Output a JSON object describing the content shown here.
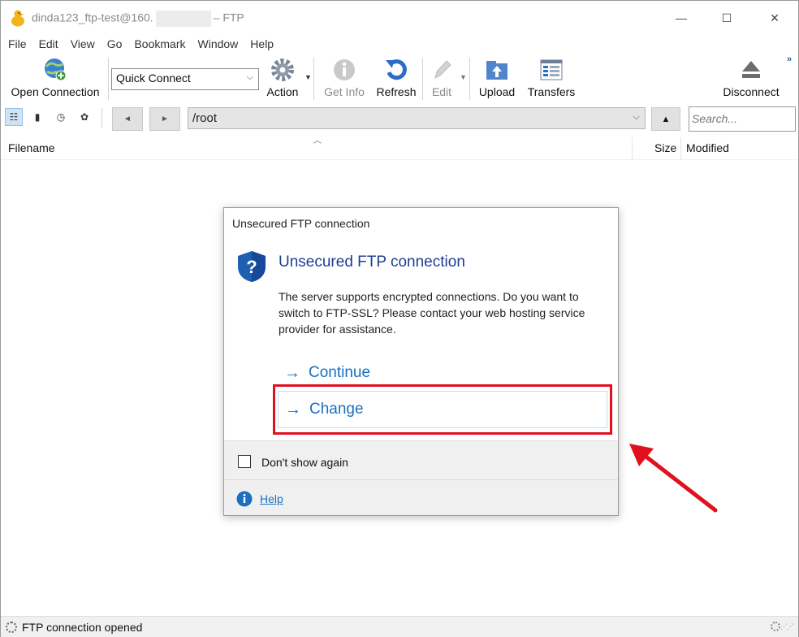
{
  "window": {
    "title_prefix": "dinda123_ftp-test@160.",
    "title_suffix": "– FTP",
    "controls": {
      "minimize": "—",
      "maximize": "☐",
      "close": "✕"
    }
  },
  "menu": [
    "File",
    "Edit",
    "View",
    "Go",
    "Bookmark",
    "Window",
    "Help"
  ],
  "toolbar": {
    "open_connection": "Open Connection",
    "quick_connect_value": "Quick Connect",
    "action": "Action",
    "get_info": "Get Info",
    "refresh": "Refresh",
    "edit": "Edit",
    "upload": "Upload",
    "transfers": "Transfers",
    "disconnect": "Disconnect"
  },
  "pathbar": {
    "back_glyph": "◄",
    "forward_glyph": "►",
    "up_glyph": "▲",
    "path": "/root",
    "search_placeholder": "Search..."
  },
  "columns": {
    "filename": "Filename",
    "size": "Size",
    "modified": "Modified"
  },
  "dialog": {
    "window_title": "Unsecured FTP connection",
    "heading": "Unsecured FTP connection",
    "body": "The server supports encrypted connections. Do you want to switch to FTP-SSL? Please contact your web hosting service provider for assistance.",
    "continue_label": "Continue",
    "change_label": "Change",
    "dont_show_label": "Don't show again",
    "dont_show_checked": false,
    "help_label": "Help",
    "accent_color": "#1a6fc2",
    "heading_color": "#1c3f94"
  },
  "annotation": {
    "highlight_color": "#e0101d",
    "highlighted_target": "Change"
  },
  "status": {
    "text": "FTP connection opened"
  }
}
